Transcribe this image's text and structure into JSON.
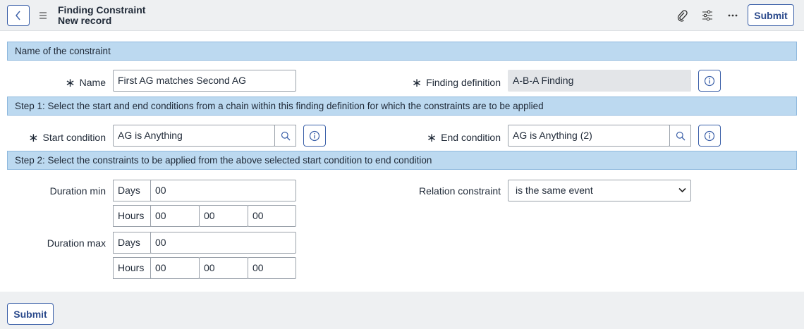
{
  "header": {
    "title": "Finding Constraint",
    "subtitle": "New record",
    "submit_label": "Submit"
  },
  "sections": {
    "name_section": "Name of the constraint",
    "step1": "Step 1: Select the start and end conditions from a chain within this finding definition for which the constraints are to be applied",
    "step2": "Step 2: Select the constraints to be applied from the above selected start condition to end condition"
  },
  "fields": {
    "name": {
      "label": "Name",
      "value": "First AG matches Second AG"
    },
    "finding_definition": {
      "label": "Finding definition",
      "value": "A-B-A Finding"
    },
    "start_condition": {
      "label": "Start condition",
      "value": "AG is Anything"
    },
    "end_condition": {
      "label": "End condition",
      "value": "AG is Anything (2)"
    },
    "duration_min": {
      "label": "Duration min",
      "days_label": "Days",
      "days": "00",
      "hours_label": "Hours",
      "hours": "00",
      "minutes": "00",
      "seconds": "00"
    },
    "duration_max": {
      "label": "Duration max",
      "days_label": "Days",
      "days": "00",
      "hours_label": "Hours",
      "hours": "00",
      "minutes": "00",
      "seconds": "00"
    },
    "relation_constraint": {
      "label": "Relation constraint",
      "value": "is the same event"
    }
  },
  "footer": {
    "submit_label": "Submit"
  },
  "icons": {
    "back": "chevron-left-icon",
    "menu": "hamburger-icon",
    "attachment": "paperclip-icon",
    "settings": "sliders-icon",
    "more": "more-horizontal-icon",
    "search": "search-icon",
    "info": "info-icon"
  },
  "colors": {
    "accent": "#3a5fa8",
    "section_bg": "#bcd9f0",
    "topbar_bg": "#eef0f2"
  }
}
